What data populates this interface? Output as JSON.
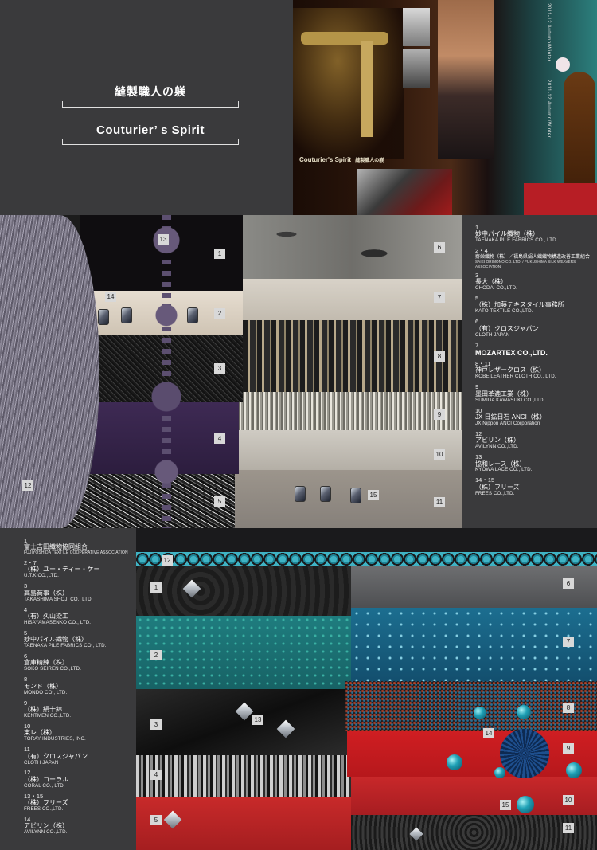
{
  "header": {
    "title_jp": "縫製職人の躾",
    "title_en": "Couturier’ s  Spirit"
  },
  "hero": {
    "caption_en": "Couturier's Spirit",
    "caption_jp": "縫製職人の躾",
    "spine_left": "2011-12 Autumn/Winter",
    "spine_right": "2011-12 Autumn/Winter"
  },
  "panel1": {
    "tags": [
      "1",
      "2",
      "3",
      "4",
      "5",
      "6",
      "7",
      "8",
      "9",
      "10",
      "11",
      "12",
      "13",
      "14",
      "15"
    ]
  },
  "list1": [
    {
      "num": "1",
      "jp": "妙中パイル織物（株）",
      "en": "TAENAKA PILE FABRICS CO., LTD."
    },
    {
      "num": "2・4",
      "jp": "齋栄織物（株）／福島県絹人織織物構造改善工業組合",
      "en": "SAIEI ORIMONO CO.,LTD. / FUKUSHIMA SILK WEAVERS ASSOCIATION"
    },
    {
      "num": "3",
      "jp": "長大（株）",
      "en": "CHODAI CO.,LTD."
    },
    {
      "num": "5",
      "jp": "（株）加藤テキスタイル事務所",
      "en": "KATO TEXTILE CO.,LTD."
    },
    {
      "num": "6",
      "jp": "（有）クロスジャパン",
      "en": "CLOTH JAPAN"
    },
    {
      "num": "7",
      "jp": "MOZARTEX CO.,LTD.",
      "en": ""
    },
    {
      "num": "8・11",
      "jp": "神戸レザークロス（株）",
      "en": "KOBE LEATHER CLOTH CO., LTD."
    },
    {
      "num": "9",
      "jp": "墨田革漉工業（株）",
      "en": "SUMIDA KAWASUKI CO.,LTD."
    },
    {
      "num": "10",
      "jp": "JX 日鉱日石 ANCI（株）",
      "en": "JX Nippon ANCI Corporation"
    },
    {
      "num": "12",
      "jp": "アビリン（株）",
      "en": "AVILYNN CO.,LTD."
    },
    {
      "num": "13",
      "jp": "協和レース（株）",
      "en": "KYOWA LACE CO., LTD."
    },
    {
      "num": "14・15",
      "jp": "（株）フリーズ",
      "en": "FREES CO.,LTD."
    }
  ],
  "list2": [
    {
      "num": "1",
      "jp": "富士吉田織物協同組合",
      "en": "FUJIYOSHIDA TEXTILE COOPERATIVE ASSOCIATION"
    },
    {
      "num": "2・7",
      "jp": "（株）ユー・ティー・ケー",
      "en": "U.T.K CO.,LTD."
    },
    {
      "num": "3",
      "jp": "高島商事（株）",
      "en": "TAKASHIMA SHOJI CO., LTD."
    },
    {
      "num": "4",
      "jp": "（有）久山染工",
      "en": "HISAYAMASENKO CO., LTD."
    },
    {
      "num": "5",
      "jp": "妙中パイル織物（株）",
      "en": "TAENAKA PILE FABRICS CO., LTD."
    },
    {
      "num": "6",
      "jp": "倉庫精練（株）",
      "en": "SOKO SEIREN CO.,LTD."
    },
    {
      "num": "8",
      "jp": "モンド（株）",
      "en": "MONDO CO., LTD."
    },
    {
      "num": "9",
      "jp": "（株）絹十綿",
      "en": "KENTMEN CO.,LTD."
    },
    {
      "num": "10",
      "jp": "東レ（株）",
      "en": "TORAY INDUSTRIES, INC."
    },
    {
      "num": "11",
      "jp": "（有）クロスジャパン",
      "en": "CLOTH JAPAN"
    },
    {
      "num": "12",
      "jp": "（株）コーラル",
      "en": "CORAL CO., LTD."
    },
    {
      "num": "13・15",
      "jp": "（株）フリーズ",
      "en": "FREES CO.,LTD."
    },
    {
      "num": "14",
      "jp": "アビリン（株）",
      "en": "AVILYNN CO.,LTD."
    }
  ],
  "panel2": {
    "tags": [
      "1",
      "2",
      "3",
      "4",
      "5",
      "6",
      "7",
      "8",
      "9",
      "10",
      "11",
      "12",
      "13",
      "14",
      "15"
    ]
  }
}
